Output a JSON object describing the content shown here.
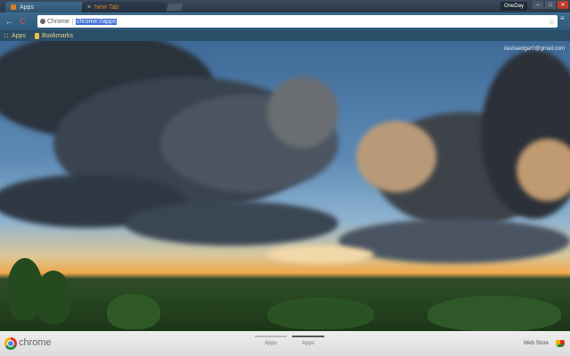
{
  "tabs": [
    {
      "label": "Apps",
      "active": true
    },
    {
      "label": "New Tab",
      "active": false
    }
  ],
  "user_badge": "OneDay",
  "window_buttons": {
    "minimize": "–",
    "maximize": "□",
    "close": "✕"
  },
  "toolbar": {
    "back_icon": "←",
    "reload_icon": "C",
    "chip_label": "Chrome",
    "url": "chrome://apps",
    "star_icon": "☆",
    "menu_icon": "≡"
  },
  "bookmarks": {
    "apps_label": "Apps",
    "bookmarks_label": "Bookmarks"
  },
  "account_email": "dashaedgar0@gmail.com",
  "bottom": {
    "brand": "chrome",
    "pages": [
      {
        "label": "Apps",
        "active": false
      },
      {
        "label": "Apps",
        "active": true
      }
    ],
    "web_store": "Web Store"
  },
  "colors": {
    "tab_accent": "#d9822a",
    "url_highlight": "#3b6fd3"
  }
}
